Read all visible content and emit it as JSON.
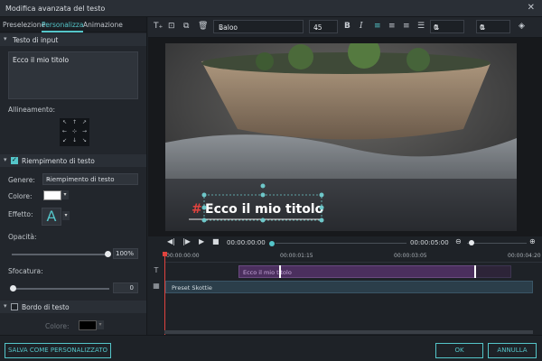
{
  "window": {
    "title": "Modifica avanzata del testo",
    "close_glyph": "✕"
  },
  "tabs": [
    {
      "label": "Preselezione",
      "active": false
    },
    {
      "label": "Personalizza",
      "active": true
    },
    {
      "label": "Animazione",
      "active": false
    }
  ],
  "text_input": {
    "section_label": "Testo di input",
    "value": "Ecco il mio titolo",
    "alignment_label": "Allineamento:"
  },
  "fill": {
    "section_label": "Riempimento di testo",
    "enabled": true,
    "type_label": "Genere:",
    "type_value": "Riempimento di testo",
    "color_label": "Colore:",
    "color": "#ffffff",
    "effect_label": "Effetto:",
    "effect_glyph": "A",
    "opacity_label": "Opacità:",
    "opacity_value": "100%",
    "blur_label": "Sfocatura:",
    "blur_value": "0"
  },
  "border": {
    "section_label": "Bordo di testo",
    "enabled": false,
    "color_label": "Colore:",
    "color": "#000000"
  },
  "toolbar": {
    "font": "Baloo",
    "size": "45",
    "bold": "B",
    "italic": "I",
    "spacing_value": "0",
    "line_height_value": "0"
  },
  "preview": {
    "title_text": "Ecco il mio titolo"
  },
  "playback": {
    "current_time": "00:00:00:00",
    "total_time": "00:00:05:00"
  },
  "timeline": {
    "ticks": [
      "00:00:00:00",
      "00:00:01:15",
      "00:00:03:05",
      "00:00:04:20"
    ],
    "title_clip_label": "Ecco il mio titolo",
    "preset_clip_label": "Preset Skottie"
  },
  "buttons": {
    "save_custom": "SALVA COME PERSONALIZZATO",
    "ok": "OK",
    "cancel": "ANNULLA"
  },
  "colors": {
    "accent": "#54c5c9",
    "playhead": "#e0433e",
    "clip_purple": "#4b2f5e"
  }
}
